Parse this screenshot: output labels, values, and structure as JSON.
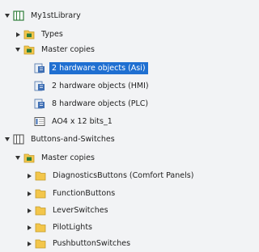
{
  "tree": {
    "items": [
      {
        "label": "My1stLibrary",
        "icon": "library-icon",
        "expander": "expanded"
      },
      {
        "label": "Types",
        "icon": "types-folder-icon",
        "expander": "collapsed"
      },
      {
        "label": "Master copies",
        "icon": "master-copies-folder-icon",
        "expander": "expanded"
      },
      {
        "label": "2 hardware objects (Asi)",
        "icon": "hardware-object-icon",
        "expander": "none",
        "selected": true
      },
      {
        "label": "2 hardware objects (HMI)",
        "icon": "hardware-object-icon",
        "expander": "none"
      },
      {
        "label": "8 hardware objects (PLC)",
        "icon": "hardware-object-icon",
        "expander": "none"
      },
      {
        "label": "AO4 x 12 bits_1",
        "icon": "module-icon",
        "expander": "none"
      },
      {
        "label": "Buttons-and-Switches",
        "icon": "library-icon",
        "expander": "expanded"
      },
      {
        "label": "Master copies",
        "icon": "master-copies-folder-icon",
        "expander": "expanded"
      },
      {
        "label": "DiagnosticsButtons (Comfort Panels)",
        "icon": "folder-icon",
        "expander": "collapsed"
      },
      {
        "label": "FunctionButtons",
        "icon": "folder-icon",
        "expander": "collapsed"
      },
      {
        "label": "LeverSwitches",
        "icon": "folder-icon",
        "expander": "collapsed"
      },
      {
        "label": "PilotLights",
        "icon": "folder-icon",
        "expander": "collapsed"
      },
      {
        "label": "PushbuttonSwitches",
        "icon": "folder-icon",
        "expander": "collapsed"
      }
    ]
  },
  "colors": {
    "background": "#f2f3f5",
    "selection": "#1f6fd1",
    "folder": "#f3c64b",
    "library": "#2f7d3a"
  }
}
